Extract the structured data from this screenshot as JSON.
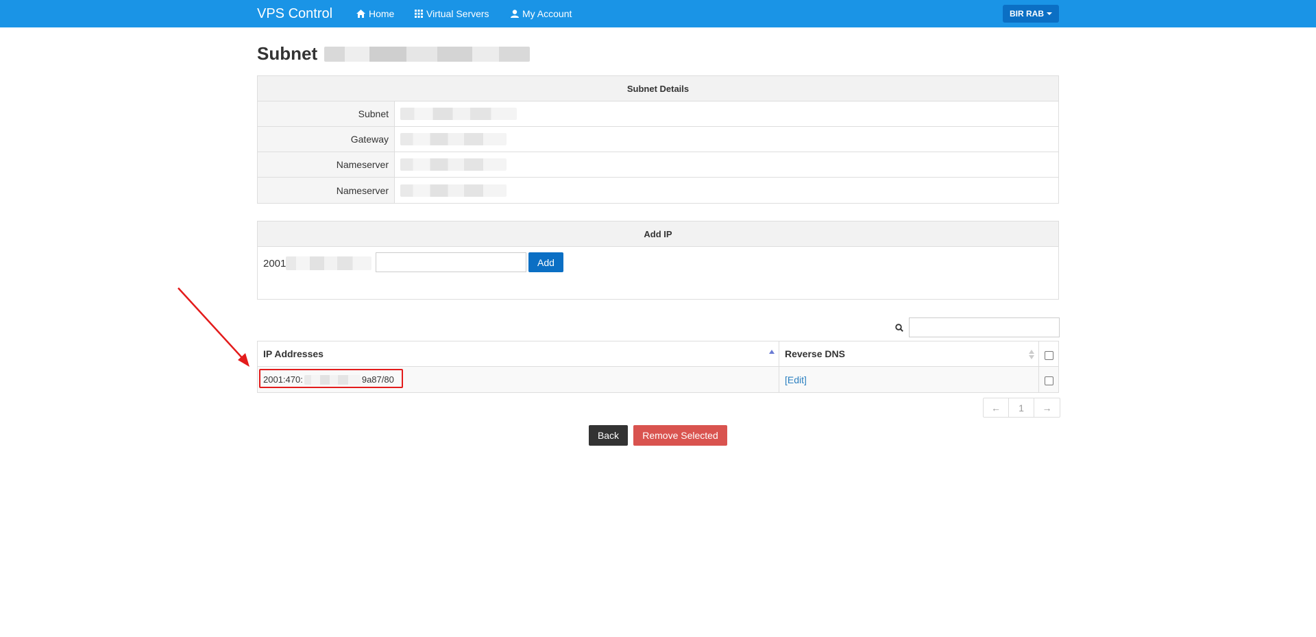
{
  "navbar": {
    "brand": "VPS Control",
    "links": [
      {
        "label": "Home",
        "icon": "home-icon"
      },
      {
        "label": "Virtual Servers",
        "icon": "grid-icon"
      },
      {
        "label": "My Account",
        "icon": "user-icon"
      }
    ],
    "user_menu": "BIR RAB",
    "color": "#1a94e6"
  },
  "page": {
    "title": "Subnet"
  },
  "subnet_details": {
    "heading": "Subnet Details",
    "rows": [
      {
        "label": "Subnet"
      },
      {
        "label": "Gateway"
      },
      {
        "label": "Nameserver"
      },
      {
        "label": "Nameserver"
      }
    ]
  },
  "add_ip": {
    "heading": "Add IP",
    "prefix": "2001",
    "input_value": "",
    "button": "Add"
  },
  "ip_table": {
    "columns": [
      "IP Addresses",
      "Reverse DNS"
    ],
    "rows": [
      {
        "ip_start": "2001:470:",
        "ip_end": "9a87/80",
        "rdns": "[Edit]"
      }
    ]
  },
  "pagination": {
    "prev": "←",
    "current": "1",
    "next": "→"
  },
  "actions": {
    "back": "Back",
    "remove": "Remove Selected",
    "remove_color": "#d9534f"
  },
  "annotation_color": "#e31b1b"
}
